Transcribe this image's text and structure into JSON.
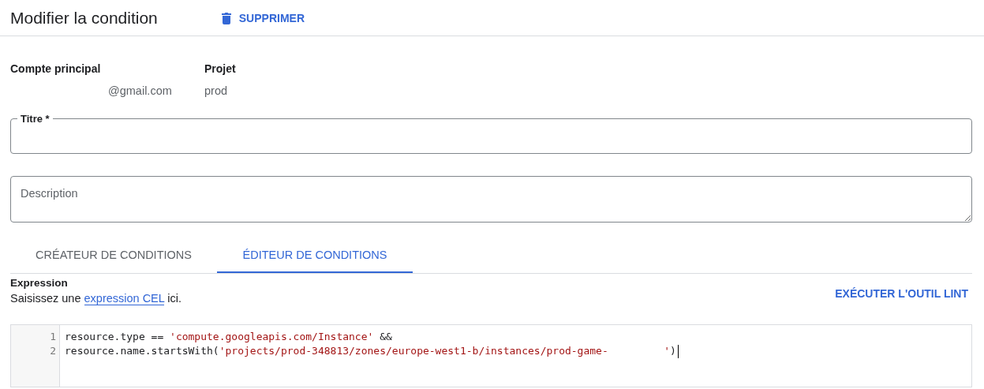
{
  "header": {
    "title": "Modifier la condition",
    "delete_button": "SUPPRIMER"
  },
  "info": [
    {
      "label": "Compte principal",
      "value": "@gmail.com"
    },
    {
      "label": "Projet",
      "value": "prod"
    }
  ],
  "title_field": {
    "label": "Titre *"
  },
  "description_field": {
    "placeholder": "Description"
  },
  "tabs": [
    {
      "label": "CRÉATEUR DE CONDITIONS",
      "selected": false
    },
    {
      "label": "ÉDITEUR DE CONDITIONS",
      "selected": true
    }
  ],
  "expression": {
    "heading": "Expression",
    "hint": {
      "before": "Saisissez une",
      "link": "expression CEL",
      "after": "ici."
    },
    "lint_button": "EXÉCUTER L'OUTIL LINT"
  },
  "code": [
    {
      "number": "1",
      "tokens": [
        {
          "kind": "plain",
          "text": "resource.type == "
        },
        {
          "kind": "string",
          "text": "'compute.googleapis.com/Instance'"
        },
        {
          "kind": "plain",
          "text": " &&"
        }
      ]
    },
    {
      "number": "2",
      "tokens": [
        {
          "kind": "plain",
          "text": "resource.name.startsWith("
        },
        {
          "kind": "string",
          "text": "'projects/prod-348813/zones/europe-west1-b/instances/prod-game-         '"
        },
        {
          "kind": "plain",
          "text": ")"
        }
      ]
    }
  ]
}
